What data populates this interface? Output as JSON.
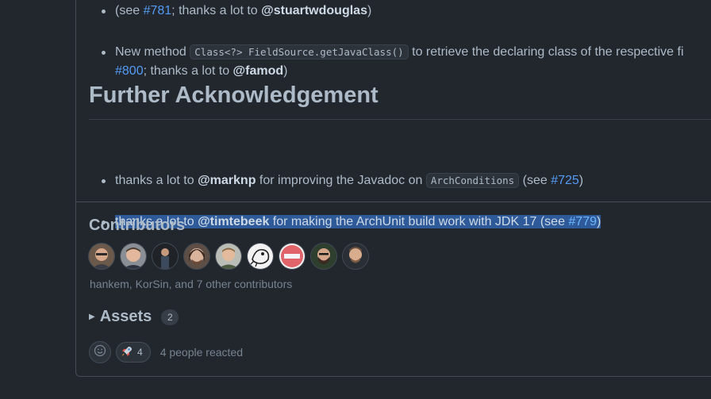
{
  "notes_top": {
    "item1": {
      "prefix": "(see ",
      "issue": "#781",
      "mid": "; thanks a lot to ",
      "user": "@stuartwdouglas",
      "suffix": ")"
    },
    "item2": {
      "prefix": "New method ",
      "code": "Class<?> FieldSource.getJavaClass()",
      "text": " to retrieve the declaring class of the respective fi",
      "issue": "#800",
      "mid": "; thanks a lot to ",
      "user": "@famod",
      "suffix": ")"
    }
  },
  "acknowledgement": {
    "heading": "Further Acknowledgement",
    "item1": {
      "prefix": "thanks a lot to ",
      "user": "@marknp",
      "text": " for improving the Javadoc on ",
      "code": "ArchConditions",
      "see": " (see ",
      "issue": "#725",
      "suffix": ")"
    },
    "item2": {
      "prefix": "thanks a lot to ",
      "user": "@timtebeek",
      "text": " for making the ArchUnit build work with JDK 17 (see ",
      "issue": "#779",
      "suffix": ")"
    }
  },
  "contributors": {
    "title": "Contributors",
    "avatar_count": 9,
    "summary": "hankem, KorSin, and 7 other contributors"
  },
  "assets": {
    "label": "Assets",
    "count": "2"
  },
  "reactions": {
    "smiley_icon": "smiley-icon",
    "rocket_icon": "rocket-icon",
    "rocket_count": "4",
    "summary": "4 people reacted"
  },
  "colors": {
    "background": "#22272e",
    "link": "#539bf5",
    "selection": "#2f5a99"
  }
}
